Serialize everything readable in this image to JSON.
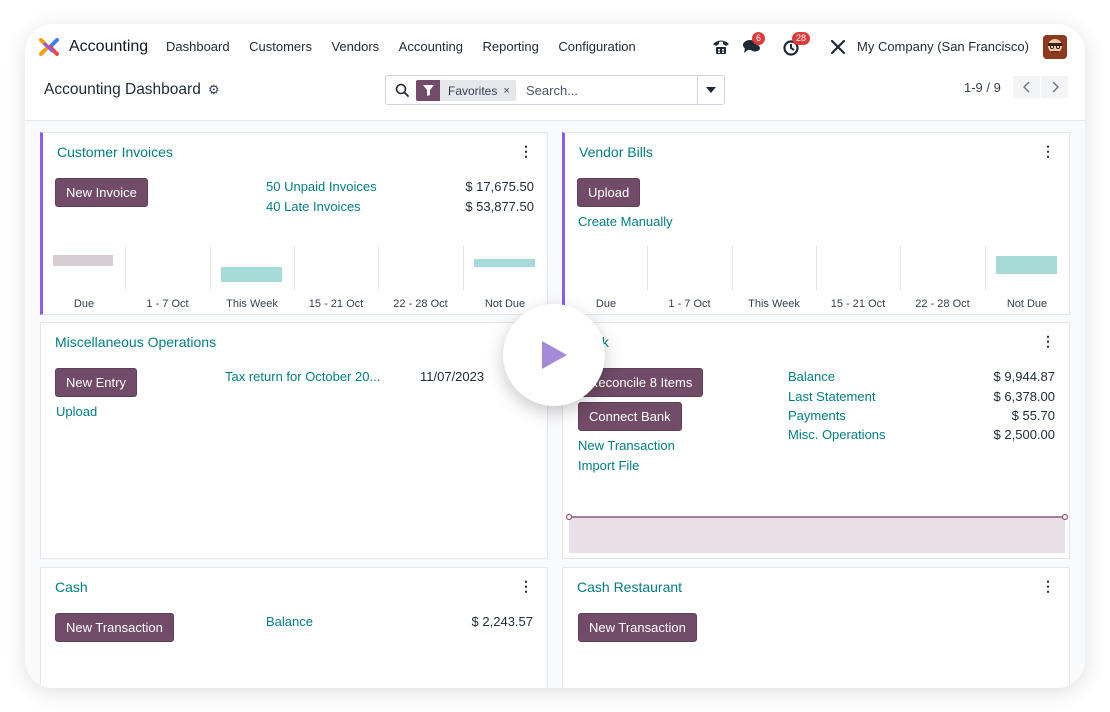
{
  "navbar": {
    "app_name": "Accounting",
    "menu": [
      "Dashboard",
      "Customers",
      "Vendors",
      "Accounting",
      "Reporting",
      "Configuration"
    ],
    "messages_badge": "6",
    "activities_badge": "28",
    "company": "My Company (San Francisco)"
  },
  "control_panel": {
    "title": "Accounting Dashboard",
    "facet_label": "Favorites",
    "facet_close": "×",
    "search_placeholder": "Search...",
    "pager": "1-9 / 9"
  },
  "cards": {
    "customer_invoices": {
      "title": "Customer Invoices",
      "kebab": "⋮",
      "button": "New Invoice",
      "links": [
        "50 Unpaid Invoices",
        "40 Late Invoices"
      ],
      "values": [
        "$ 17,675.50",
        "$ 53,877.50"
      ],
      "chart_labels": [
        "Due",
        "1 - 7 Oct",
        "This Week",
        "15 - 21 Oct",
        "22 - 28 Oct",
        "Not Due"
      ]
    },
    "vendor_bills": {
      "title": "Vendor Bills",
      "kebab": "⋮",
      "button": "Upload",
      "link": "Create Manually",
      "chart_labels": [
        "Due",
        "1 - 7 Oct",
        "This Week",
        "15 - 21 Oct",
        "22 - 28 Oct",
        "Not Due"
      ]
    },
    "misc_operations": {
      "title": "Miscellaneous Operations",
      "button": "New Entry",
      "link": "Upload",
      "entry_label": "Tax return for October 20...",
      "entry_date": "11/07/2023"
    },
    "bank": {
      "title": "Bank",
      "kebab": "⋮",
      "reconcile_button": "Reconcile 8 Items",
      "connect_button": "Connect Bank",
      "links": [
        "New Transaction",
        "Import File"
      ],
      "stat_labels": [
        "Balance",
        "Last Statement",
        "Payments",
        "Misc. Operations"
      ],
      "stat_values": [
        "$ 9,944.87",
        "$ 6,378.00",
        "$ 55.70",
        "$ 2,500.00"
      ]
    },
    "cash": {
      "title": "Cash",
      "kebab": "⋮",
      "button": "New Transaction",
      "stat_label": "Balance",
      "stat_value": "$ 2,243.57"
    },
    "cash_restaurant": {
      "title": "Cash Restaurant",
      "kebab": "⋮",
      "button": "New Transaction"
    }
  },
  "colors": {
    "primary": "#714b67",
    "link": "#017e84",
    "accent_border": "#8b5cf6",
    "bar_overdue": "#d8cdd3",
    "bar_future": "#a7dbd8"
  }
}
